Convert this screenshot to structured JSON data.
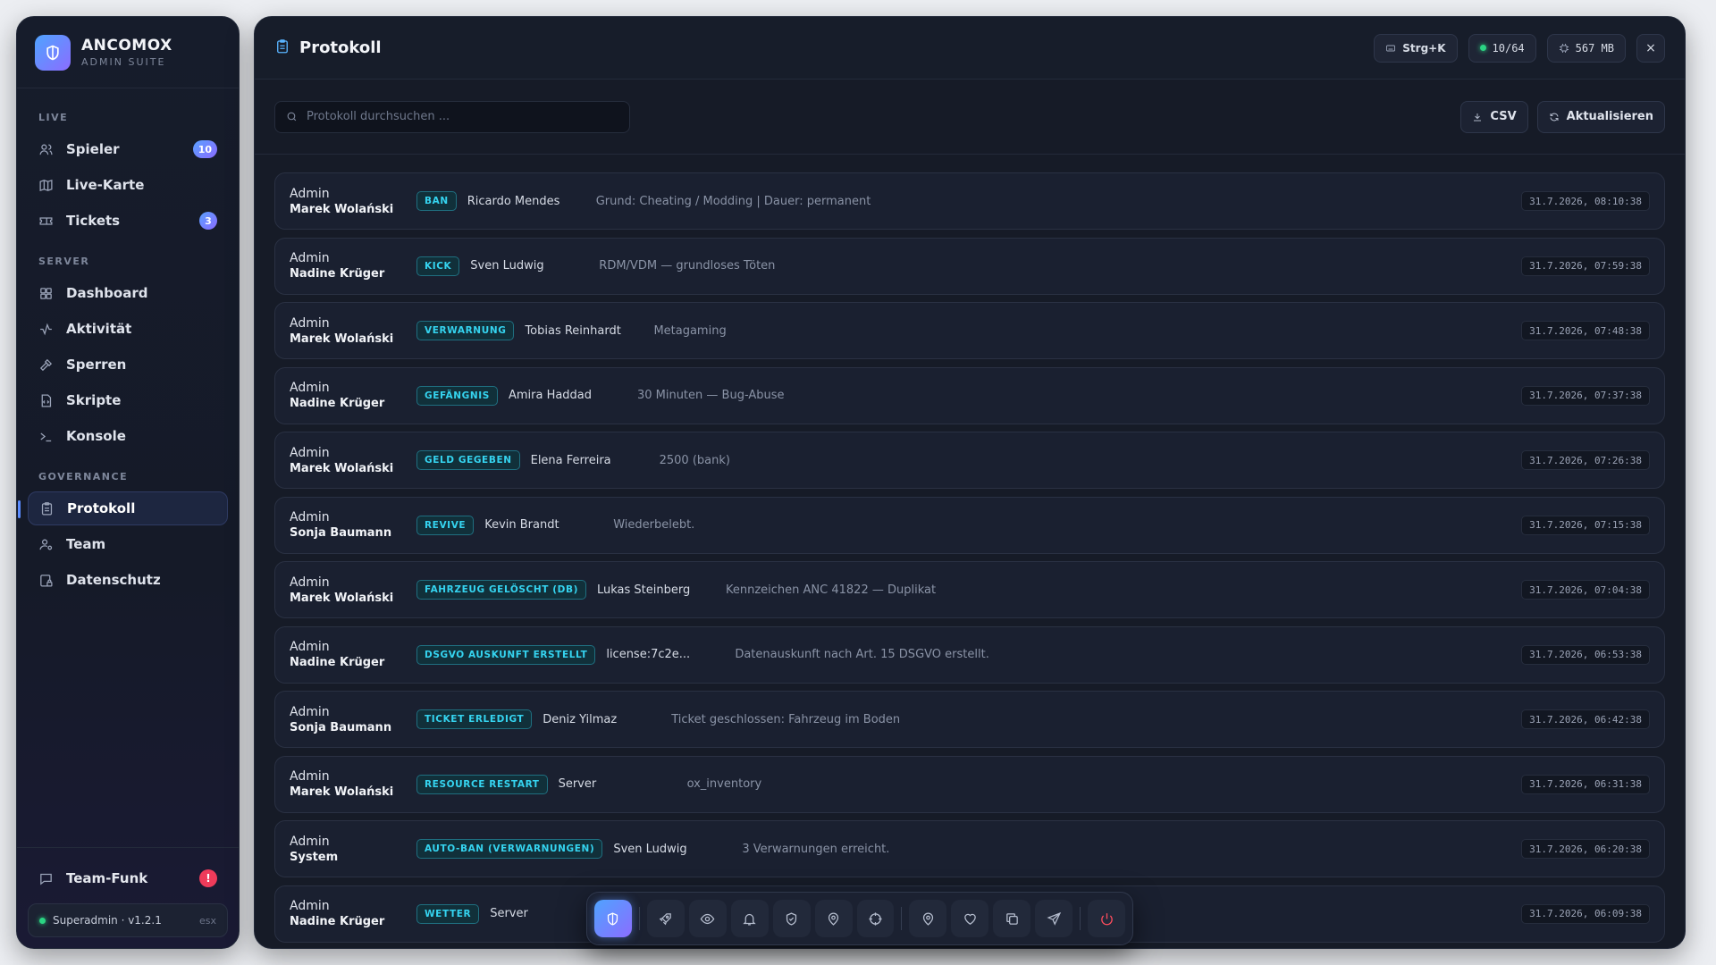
{
  "brand": {
    "title": "ANCOMOX",
    "subtitle": "ADMIN SUITE"
  },
  "sidebar": {
    "sections": [
      {
        "label": "LIVE",
        "items": [
          {
            "label": "Spieler",
            "icon": "users-icon",
            "badge": "10"
          },
          {
            "label": "Live-Karte",
            "icon": "map-icon"
          },
          {
            "label": "Tickets",
            "icon": "ticket-icon",
            "badge": "3"
          }
        ]
      },
      {
        "label": "SERVER",
        "items": [
          {
            "label": "Dashboard",
            "icon": "grid-icon"
          },
          {
            "label": "Aktivität",
            "icon": "activity-icon"
          },
          {
            "label": "Sperren",
            "icon": "hammer-icon"
          },
          {
            "label": "Skripte",
            "icon": "file-code-icon"
          },
          {
            "label": "Konsole",
            "icon": "terminal-icon"
          }
        ]
      },
      {
        "label": "GOVERNANCE",
        "items": [
          {
            "label": "Protokoll",
            "icon": "clipboard-icon",
            "active": true
          },
          {
            "label": "Team",
            "icon": "user-cog-icon"
          },
          {
            "label": "Datenschutz",
            "icon": "clipboard-lock-icon"
          }
        ]
      }
    ],
    "team_funk": {
      "label": "Team-Funk",
      "alert": "!"
    },
    "status": {
      "text": "Superadmin · v1.2.1",
      "tag": "esx"
    }
  },
  "header": {
    "title": "Protokoll",
    "shortcut": "Strg+K",
    "players": "10/64",
    "memory": "567 MB",
    "close": "×"
  },
  "toolbar": {
    "search_placeholder": "Protokoll durchsuchen ...",
    "csv_label": "CSV",
    "refresh_label": "Aktualisieren"
  },
  "log": [
    {
      "role": "Admin",
      "name": "Marek Wolański",
      "action": "BAN",
      "target": "Ricardo Mendes",
      "detail": "Grund: Cheating / Modding | Dauer: permanent",
      "time": "31.7.2026, 08:10:38"
    },
    {
      "role": "Admin",
      "name": "Nadine Krüger",
      "action": "KICK",
      "target": "Sven Ludwig",
      "detail": "RDM/VDM — grundloses Töten",
      "time": "31.7.2026, 07:59:38"
    },
    {
      "role": "Admin",
      "name": "Marek Wolański",
      "action": "VERWARNUNG",
      "target": "Tobias Reinhardt",
      "detail": "Metagaming",
      "time": "31.7.2026, 07:48:38"
    },
    {
      "role": "Admin",
      "name": "Nadine Krüger",
      "action": "GEFÄNGNIS",
      "target": "Amira Haddad",
      "detail": "30 Minuten — Bug-Abuse",
      "time": "31.7.2026, 07:37:38"
    },
    {
      "role": "Admin",
      "name": "Marek Wolański",
      "action": "GELD GEGEBEN",
      "target": "Elena Ferreira",
      "detail": "2500 (bank)",
      "time": "31.7.2026, 07:26:38"
    },
    {
      "role": "Admin",
      "name": "Sonja Baumann",
      "action": "REVIVE",
      "target": "Kevin Brandt",
      "detail": "Wiederbelebt.",
      "time": "31.7.2026, 07:15:38"
    },
    {
      "role": "Admin",
      "name": "Marek Wolański",
      "action": "FAHRZEUG GELÖSCHT (DB)",
      "target": "Lukas Steinberg",
      "detail": "Kennzeichen ANC 41822 — Duplikat",
      "time": "31.7.2026, 07:04:38"
    },
    {
      "role": "Admin",
      "name": "Nadine Krüger",
      "action": "DSGVO AUSKUNFT ERSTELLT",
      "target": "license:7c2e...",
      "detail": "Datenauskunft nach Art. 15 DSGVO erstellt.",
      "time": "31.7.2026, 06:53:38"
    },
    {
      "role": "Admin",
      "name": "Sonja Baumann",
      "action": "TICKET ERLEDIGT",
      "target": "Deniz Yilmaz",
      "detail": "Ticket geschlossen: Fahrzeug im Boden",
      "time": "31.7.2026, 06:42:38"
    },
    {
      "role": "Admin",
      "name": "Marek Wolański",
      "action": "RESOURCE RESTART",
      "target": "Server",
      "detail": "ox_inventory",
      "time": "31.7.2026, 06:31:38"
    },
    {
      "role": "Admin",
      "name": "System",
      "action": "AUTO-BAN (VERWARNUNGEN)",
      "target": "Sven Ludwig",
      "detail": "3 Verwarnungen erreicht.",
      "time": "31.7.2026, 06:20:38"
    },
    {
      "role": "Admin",
      "name": "Nadine Krüger",
      "action": "WETTER",
      "target": "Server",
      "detail": "",
      "time": "31.7.2026, 06:09:38"
    }
  ],
  "dock": [
    {
      "icon": "shield-icon",
      "primary": true
    },
    {
      "icon": "rocket-icon"
    },
    {
      "icon": "eye-icon"
    },
    {
      "icon": "bell-icon"
    },
    {
      "icon": "shield-check-icon"
    },
    {
      "icon": "map-pin-icon"
    },
    {
      "icon": "crosshair-icon"
    },
    {
      "icon": "location-pin-icon"
    },
    {
      "icon": "heart-icon"
    },
    {
      "icon": "copy-icon"
    },
    {
      "icon": "send-icon"
    },
    {
      "icon": "power-icon",
      "danger": true
    }
  ],
  "colors": {
    "accent": "#5b8cff",
    "tag_text": "#35d4f0",
    "danger": "#ef3b5a",
    "online": "#2bd483"
  }
}
